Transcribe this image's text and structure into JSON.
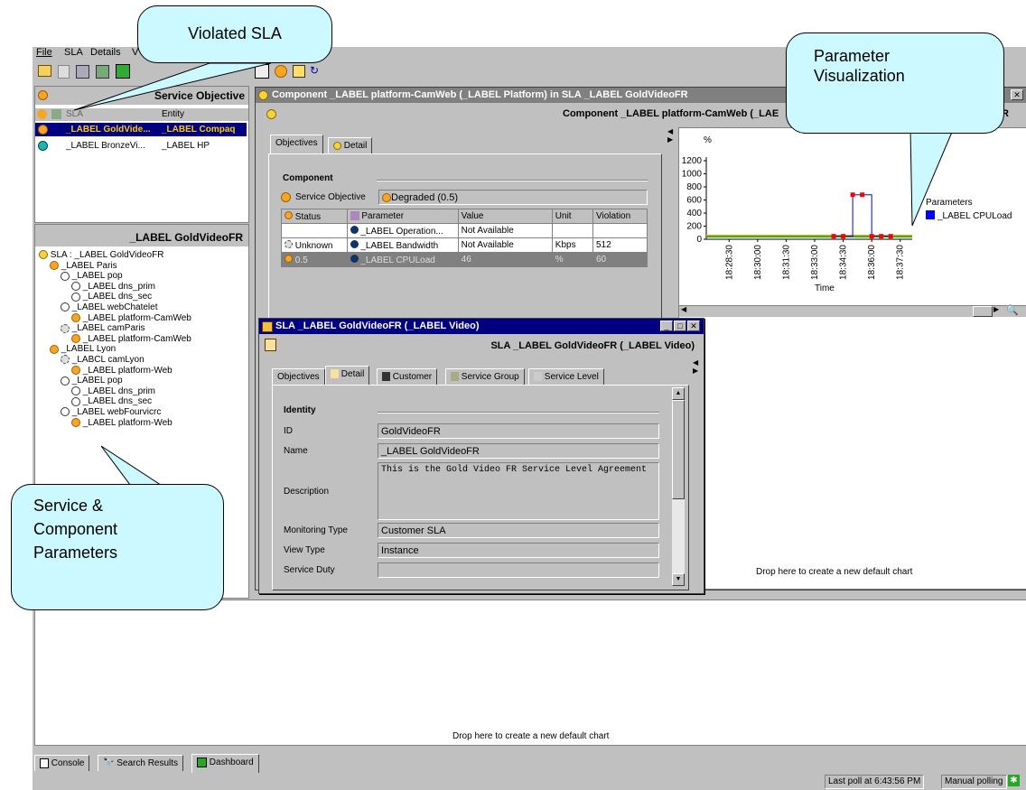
{
  "menu": {
    "items": [
      "File",
      "SLA",
      "Details",
      "V"
    ]
  },
  "callouts": {
    "violated": "Violated SLA",
    "param_viz_line1": "Parameter",
    "param_viz_line2": "Visualization",
    "service_line1": "Service &",
    "service_line2": "Component",
    "service_line3": "Parameters"
  },
  "left_top": {
    "header": "Service Objective",
    "col_entity": "Entity",
    "col_sla": "SLA",
    "rows": [
      {
        "sla": "_LABEL GoldVide...",
        "entity": "_LABEL Compaq",
        "selected": true
      },
      {
        "sla": "_LABEL BronzeVi...",
        "entity": "_LABEL HP",
        "selected": false
      }
    ]
  },
  "left_tree": {
    "header": "_LABEL GoldVideoFR",
    "nodes": [
      "SLA : _LABEL GoldVideoFR",
      "_LABEL Paris",
      "_LABEL pop",
      "_LABEL dns_prim",
      "_LABEL dns_sec",
      "_LABEL webChatelet",
      "_LABEL platform-CamWeb",
      "_LABEL camParis",
      "_LABEL platform-CamWeb",
      "_LABEL Lyon",
      "_LABCL camLyon",
      "_LABEL platform-Web",
      "_LABEL pop",
      "_LABEL dns_prim",
      "_LABEL dns_sec",
      "_LABEL webFourvicrc",
      "_LABEL platform-Web"
    ]
  },
  "component_window": {
    "title": "Component _LABEL platform-CamWeb (_LABEL Platform) in SLA _LABEL GoldVideoFR",
    "heading": "Component _LABEL platform-CamWeb (_LAE",
    "heading_tail": "R",
    "tabs": [
      "Objectives",
      "Detail"
    ],
    "section": "Component",
    "so_label": "Service Objective",
    "so_value": "Degraded (0.5)",
    "table": {
      "headers": [
        "Status",
        "Parameter",
        "Value",
        "Unit",
        "Violation"
      ],
      "rows": [
        [
          "",
          "_LABEL Operation...",
          "Not Available",
          "",
          ""
        ],
        [
          "Unknown",
          "_LABEL Bandwidth",
          "Not Available",
          "Kbps",
          "512"
        ],
        [
          "0.5",
          "_LABEL CPULoad",
          "46",
          "%",
          "60"
        ]
      ]
    }
  },
  "chart_data": {
    "type": "line",
    "ylabel": "%",
    "xlabel": "Time",
    "yticks": [
      "1200",
      "1000",
      "800",
      "600",
      "400",
      "200",
      "0"
    ],
    "xticks": [
      "18:28:30",
      "18:30:00",
      "18:31:30",
      "18:33:00",
      "18:34:30",
      "18:36:00",
      "18:37:30"
    ],
    "ylim": [
      0,
      1200
    ],
    "legend_title": "Parameters",
    "series": [
      {
        "name": "_LABEL CPULoad",
        "color": "#0000ff",
        "x": [
          "18:34:00",
          "18:34:30",
          "18:35:00",
          "18:35:30",
          "18:36:00",
          "18:36:30",
          "18:37:00"
        ],
        "values": [
          46,
          46,
          680,
          680,
          46,
          46,
          46
        ]
      }
    ],
    "thresholds": [
      {
        "value": 60,
        "color": "#e0b000"
      },
      {
        "value": 40,
        "color": "#00a000"
      }
    ],
    "footer": "Drop here to create a new default chart"
  },
  "sla_window": {
    "title": "SLA _LABEL GoldVideoFR (_LABEL Video)",
    "heading": "SLA _LABEL GoldVideoFR (_LABEL Video)",
    "tabs": [
      "Objectives",
      "Detail",
      "Customer",
      "Service Group",
      "Service Level"
    ],
    "section": "Identity",
    "fields": {
      "id_label": "ID",
      "id_value": "GoldVideoFR",
      "name_label": "Name",
      "name_value": "_LABEL GoldVideoFR",
      "desc_label": "Description",
      "desc_value": "This is the Gold Video FR Service Level Agreement",
      "mon_label": "Monitoring Type",
      "mon_value": "Customer SLA",
      "view_label": "View Type",
      "view_value": "Instance",
      "duty_label": "Service Duty",
      "duty_value": ""
    }
  },
  "bottom": {
    "drop_text": "Drop here to create a new default chart",
    "tabs": [
      "Console",
      "Search Results",
      "Dashboard"
    ]
  },
  "status": {
    "last_poll": "Last poll at 6:43:56 PM",
    "polling": "Manual polling"
  }
}
